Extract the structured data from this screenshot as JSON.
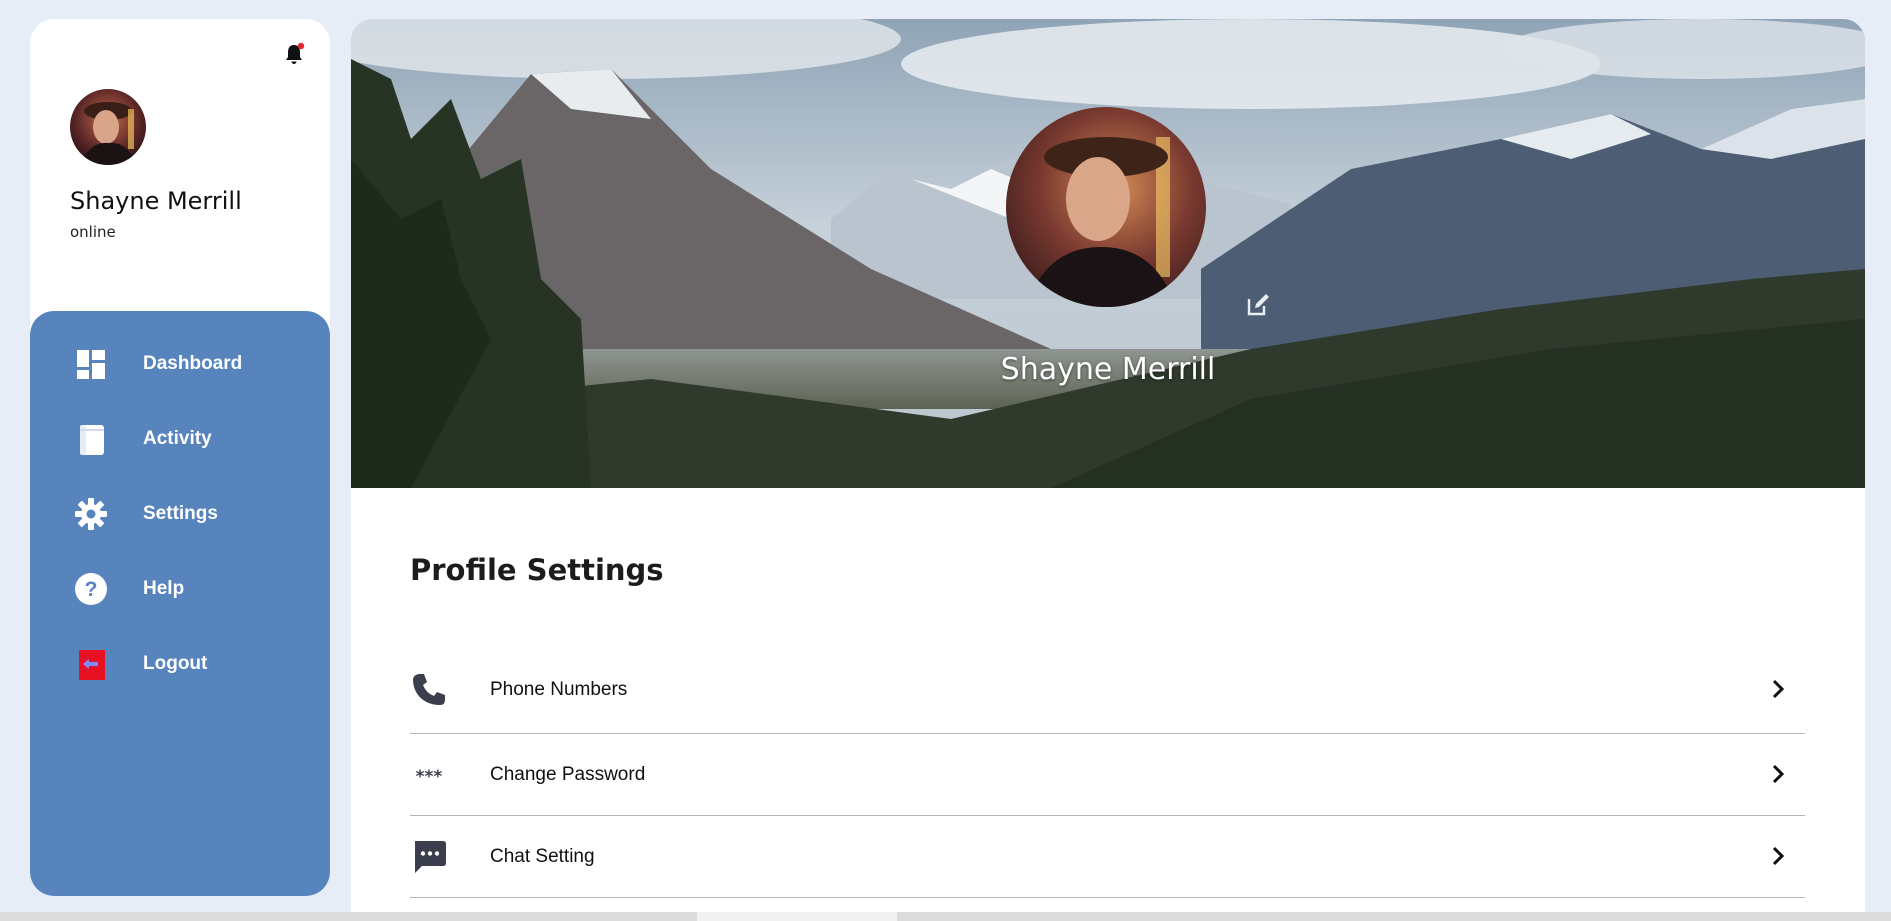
{
  "user": {
    "name": "Shayne Merrill",
    "status": "online"
  },
  "sidebar": {
    "items": [
      {
        "label": "Dashboard",
        "icon": "dashboard-icon"
      },
      {
        "label": "Activity",
        "icon": "book-icon"
      },
      {
        "label": "Settings",
        "icon": "gear-icon"
      },
      {
        "label": "Help",
        "icon": "question-circle-icon"
      },
      {
        "label": "Logout",
        "icon": "logout-icon"
      }
    ]
  },
  "profile": {
    "name": "Shayne Merrill"
  },
  "settings": {
    "title": "Profile Settings",
    "items": [
      {
        "label": "Phone Numbers",
        "icon": "phone-icon"
      },
      {
        "label": "Change Password",
        "icon": "asterisks-icon"
      },
      {
        "label": "Chat Setting",
        "icon": "chat-bubble-icon"
      }
    ]
  },
  "colors": {
    "page_background": "#e6edf7",
    "nav_background": "#5784bd",
    "notification_dot": "#e0282e",
    "logout_icon": "#e81123",
    "icon_dark": "#3b3e4c"
  }
}
